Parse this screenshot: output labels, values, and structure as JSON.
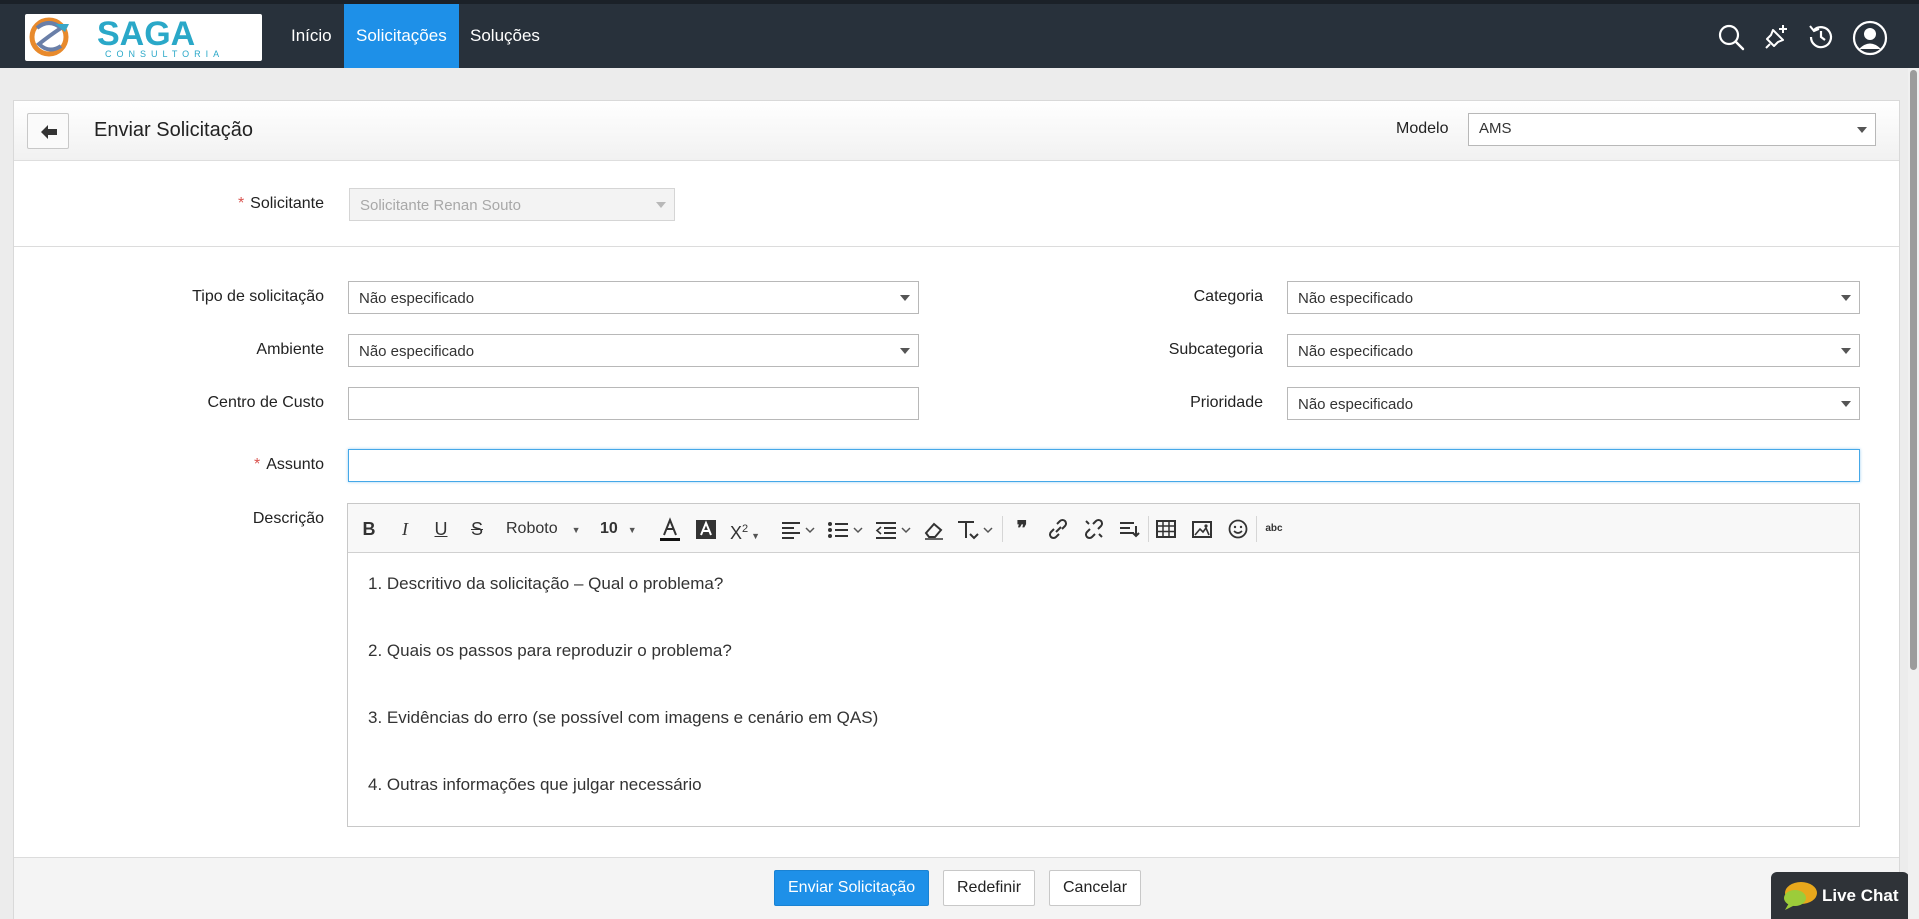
{
  "nav": {
    "logo_name": "SAGA",
    "logo_sub": "CONSULTORIA",
    "items": [
      {
        "label": "Início"
      },
      {
        "label": "Solicitações"
      },
      {
        "label": "Soluções"
      }
    ],
    "active_color": "#1e90e8",
    "icons": [
      "search-icon",
      "new-request-icon",
      "history-icon",
      "user-avatar-icon"
    ]
  },
  "header": {
    "title": "Enviar Solicitação",
    "modelo_label": "Modelo",
    "modelo_value": "AMS"
  },
  "requester": {
    "label": "Solicitante",
    "value": "Solicitante Renan Souto"
  },
  "fields": {
    "tipo": {
      "label": "Tipo de solicitação",
      "value": "Não especificado"
    },
    "categoria": {
      "label": "Categoria",
      "value": "Não especificado"
    },
    "ambiente": {
      "label": "Ambiente",
      "value": "Não especificado"
    },
    "subcategoria": {
      "label": "Subcategoria",
      "value": "Não especificado"
    },
    "centro": {
      "label": "Centro de Custo",
      "value": ""
    },
    "prioridade": {
      "label": "Prioridade",
      "value": "Não especificado"
    },
    "assunto": {
      "label": "Assunto",
      "value": ""
    },
    "descricao": {
      "label": "Descrição"
    }
  },
  "editor": {
    "font_family": "Roboto",
    "font_size": "10",
    "lines": [
      "1. Descritivo da solicitação – Qual o problema?",
      "2. Quais os passos para reproduzir o problema?",
      "3. Evidências do erro (se possível com imagens e cenário em QAS)",
      "4. Outras informações que julgar necessário"
    ]
  },
  "footer": {
    "submit": "Enviar Solicitação",
    "reset": "Redefinir",
    "cancel": "Cancelar"
  },
  "live_chat": {
    "label": "Live Chat"
  }
}
